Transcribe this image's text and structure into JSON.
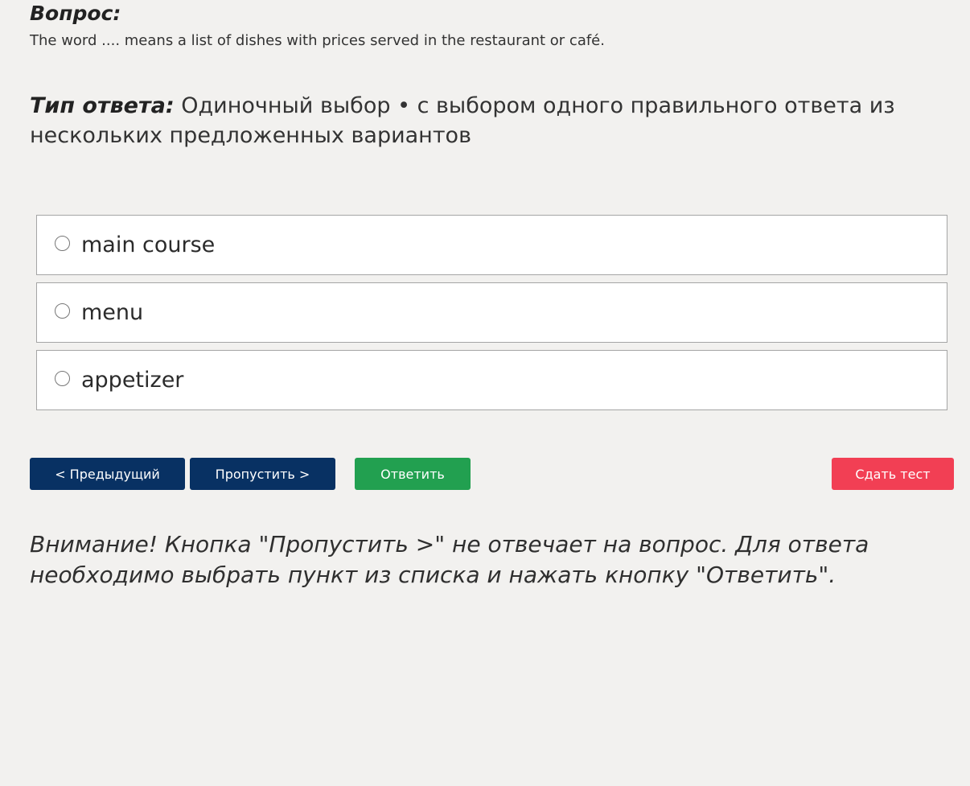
{
  "question": {
    "heading": "Вопрос:",
    "text": "The word .... means a list of dishes with prices served in the restaurant or café."
  },
  "answer_type": {
    "label": "Тип ответа:",
    "value": "Одиночный выбор • с выбором одного правильного ответа из нескольких предложенных вариантов"
  },
  "options": [
    {
      "label": "main course",
      "selected": false
    },
    {
      "label": "menu",
      "selected": false
    },
    {
      "label": "appetizer",
      "selected": false
    }
  ],
  "buttons": {
    "previous": "< Предыдущий",
    "skip": "Пропустить >",
    "answer": "Ответить",
    "submit": "Сдать тест"
  },
  "colors": {
    "nav_button": "#083163",
    "answer_button": "#22a050",
    "submit_button": "#f23f54",
    "background": "#f2f1ef"
  },
  "warning": "Внимание! Кнопка \"Пропустить >\" не отвечает на вопрос. Для ответа необходимо выбрать пункт из списка и нажать кнопку \"Ответить\"."
}
